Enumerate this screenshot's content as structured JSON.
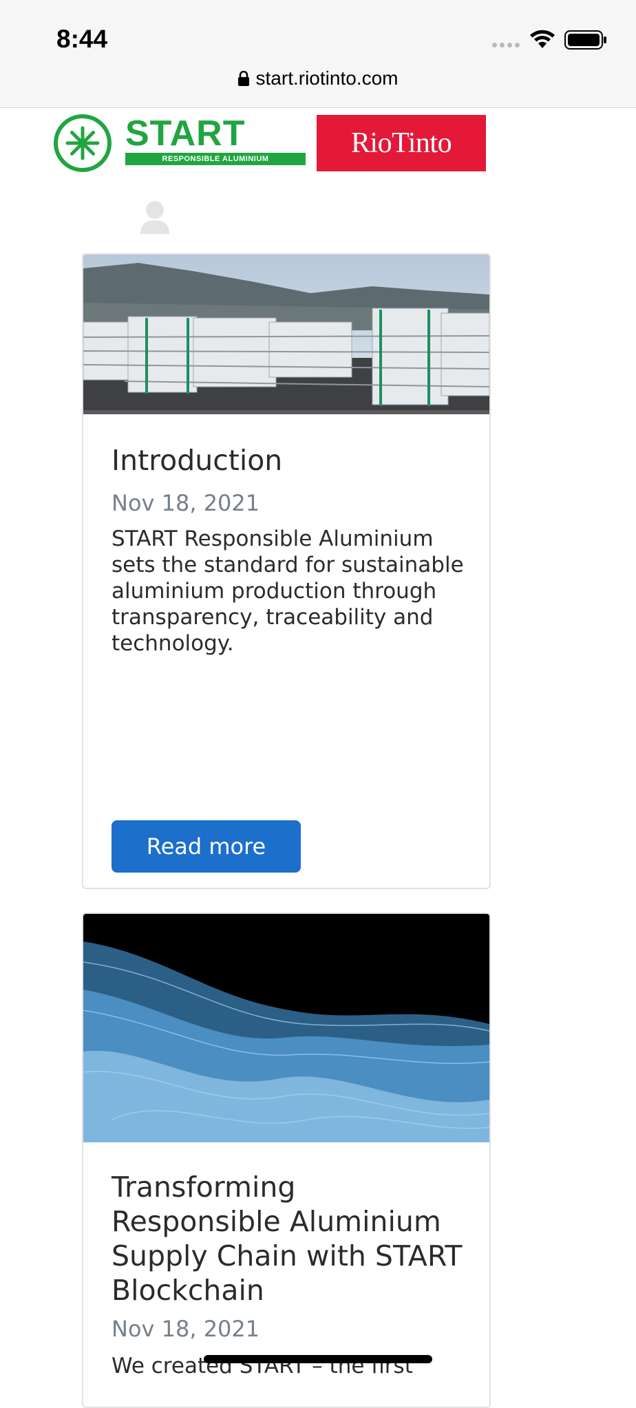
{
  "status_bar": {
    "time": "8:44"
  },
  "browser": {
    "url": "start.riotinto.com"
  },
  "header": {
    "start_logo_word": "START",
    "start_logo_subtitle": "RESPONSIBLE ALUMINIUM",
    "rio_logo_text": "RioTinto"
  },
  "colors": {
    "start_green": "#21a540",
    "rio_red": "#e31937",
    "button_blue": "#1d6fcc",
    "date_gray": "#76808a"
  },
  "cards": [
    {
      "image": "aluminium-ingot-stacks-photo",
      "title": "Introduction",
      "date": "Nov 18, 2021",
      "description": "START Responsible Aluminium sets the standard for sustainable aluminium production through transparency, traceability and technology.",
      "button_label": "Read more"
    },
    {
      "image": "blue-data-waves-illustration",
      "title": "Transforming Responsible Aluminium Supply Chain with START Blockchain",
      "date": "Nov 18, 2021",
      "description": "We created START – the first"
    }
  ]
}
